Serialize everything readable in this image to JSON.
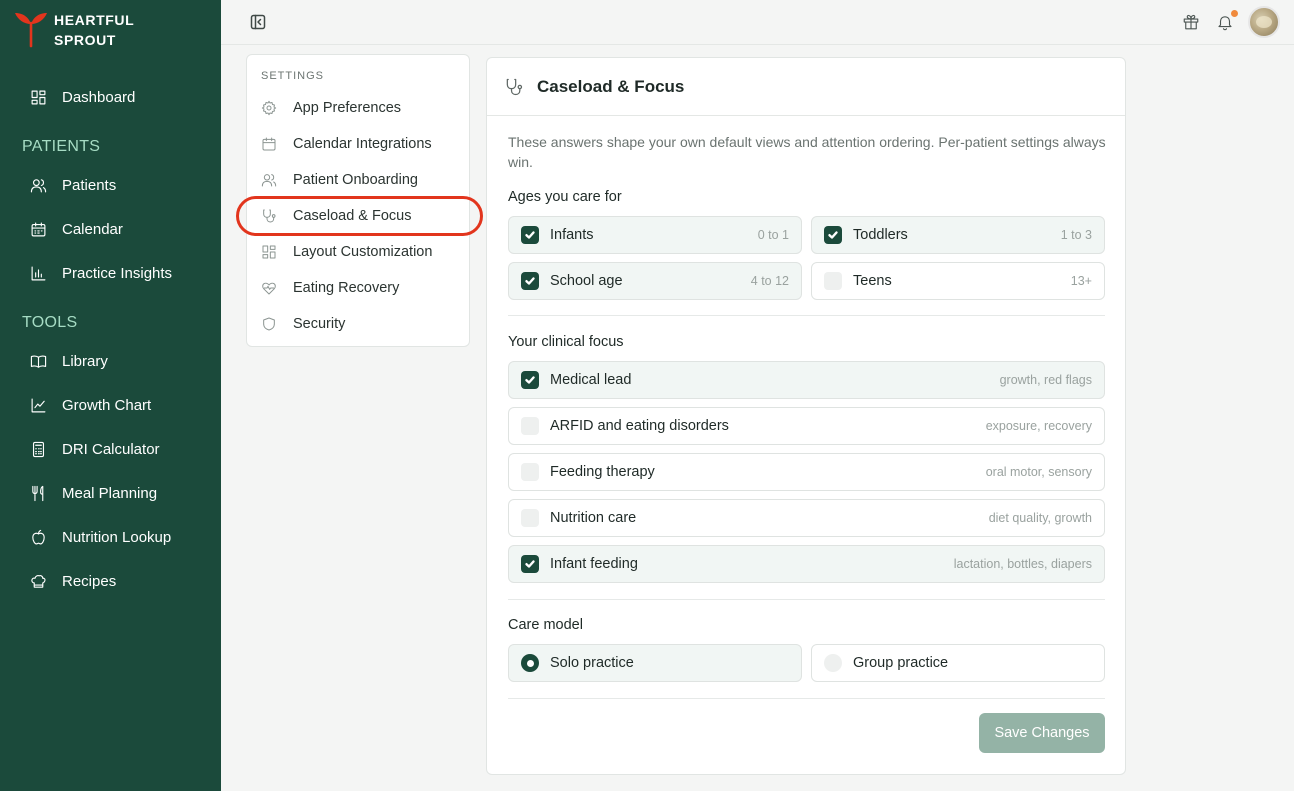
{
  "brand": {
    "name_line1": "HEARTFUL",
    "name_line2": "SPROUT",
    "logo": "sprout-logo",
    "accent": "#e2351d"
  },
  "sidebar": {
    "dashboard": {
      "label": "Dashboard",
      "icon": "grid-icon"
    },
    "sections": [
      {
        "title": "PATIENTS",
        "items": [
          {
            "label": "Patients",
            "icon": "users-icon"
          },
          {
            "label": "Calendar",
            "icon": "calendar-icon"
          },
          {
            "label": "Practice Insights",
            "icon": "bar-chart-icon"
          }
        ]
      },
      {
        "title": "TOOLS",
        "items": [
          {
            "label": "Library",
            "icon": "book-icon"
          },
          {
            "label": "Growth Chart",
            "icon": "line-chart-icon"
          },
          {
            "label": "DRI Calculator",
            "icon": "calculator-icon"
          },
          {
            "label": "Meal Planning",
            "icon": "utensils-icon"
          },
          {
            "label": "Nutrition Lookup",
            "icon": "apple-icon"
          },
          {
            "label": "Recipes",
            "icon": "chef-hat-icon"
          }
        ]
      }
    ],
    "bg_color": "#1b4a3b",
    "section_color": "#a6dcc4"
  },
  "settings_nav": {
    "title": "SETTINGS",
    "items": [
      {
        "label": "App Preferences",
        "icon": "gear-icon"
      },
      {
        "label": "Calendar Integrations",
        "icon": "calendar-icon"
      },
      {
        "label": "Patient Onboarding",
        "icon": "users-icon"
      },
      {
        "label": "Caseload & Focus",
        "icon": "stethoscope-icon",
        "active": true
      },
      {
        "label": "Layout Customization",
        "icon": "layout-icon"
      },
      {
        "label": "Eating Recovery",
        "icon": "heart-pulse-icon"
      },
      {
        "label": "Security",
        "icon": "shield-icon"
      }
    ]
  },
  "main": {
    "title": "Caseload & Focus",
    "intro": "These answers shape your own default views and attention ordering. Per-patient settings always win.",
    "ages": {
      "label": "Ages you care for",
      "options": [
        {
          "label": "Infants",
          "hint": "0 to 1",
          "checked": true
        },
        {
          "label": "Toddlers",
          "hint": "1 to 3",
          "checked": true
        },
        {
          "label": "School age",
          "hint": "4 to 12",
          "checked": true
        },
        {
          "label": "Teens",
          "hint": "13+",
          "checked": false
        }
      ]
    },
    "focus": {
      "label": "Your clinical focus",
      "options": [
        {
          "label": "Medical lead",
          "hint": "growth, red flags",
          "checked": true
        },
        {
          "label": "ARFID and eating disorders",
          "hint": "exposure, recovery",
          "checked": false
        },
        {
          "label": "Feeding therapy",
          "hint": "oral motor, sensory",
          "checked": false
        },
        {
          "label": "Nutrition care",
          "hint": "diet quality, growth",
          "checked": false
        },
        {
          "label": "Infant feeding",
          "hint": "lactation, bottles, diapers",
          "checked": true
        }
      ]
    },
    "care_model": {
      "label": "Care model",
      "options": [
        {
          "label": "Solo practice",
          "selected": true
        },
        {
          "label": "Group practice",
          "selected": false
        }
      ]
    },
    "save_label": "Save Changes"
  },
  "topbar": {
    "icons": [
      "sidebar-collapse-icon",
      "gift-icon",
      "bell-icon"
    ],
    "has_notification": true
  }
}
